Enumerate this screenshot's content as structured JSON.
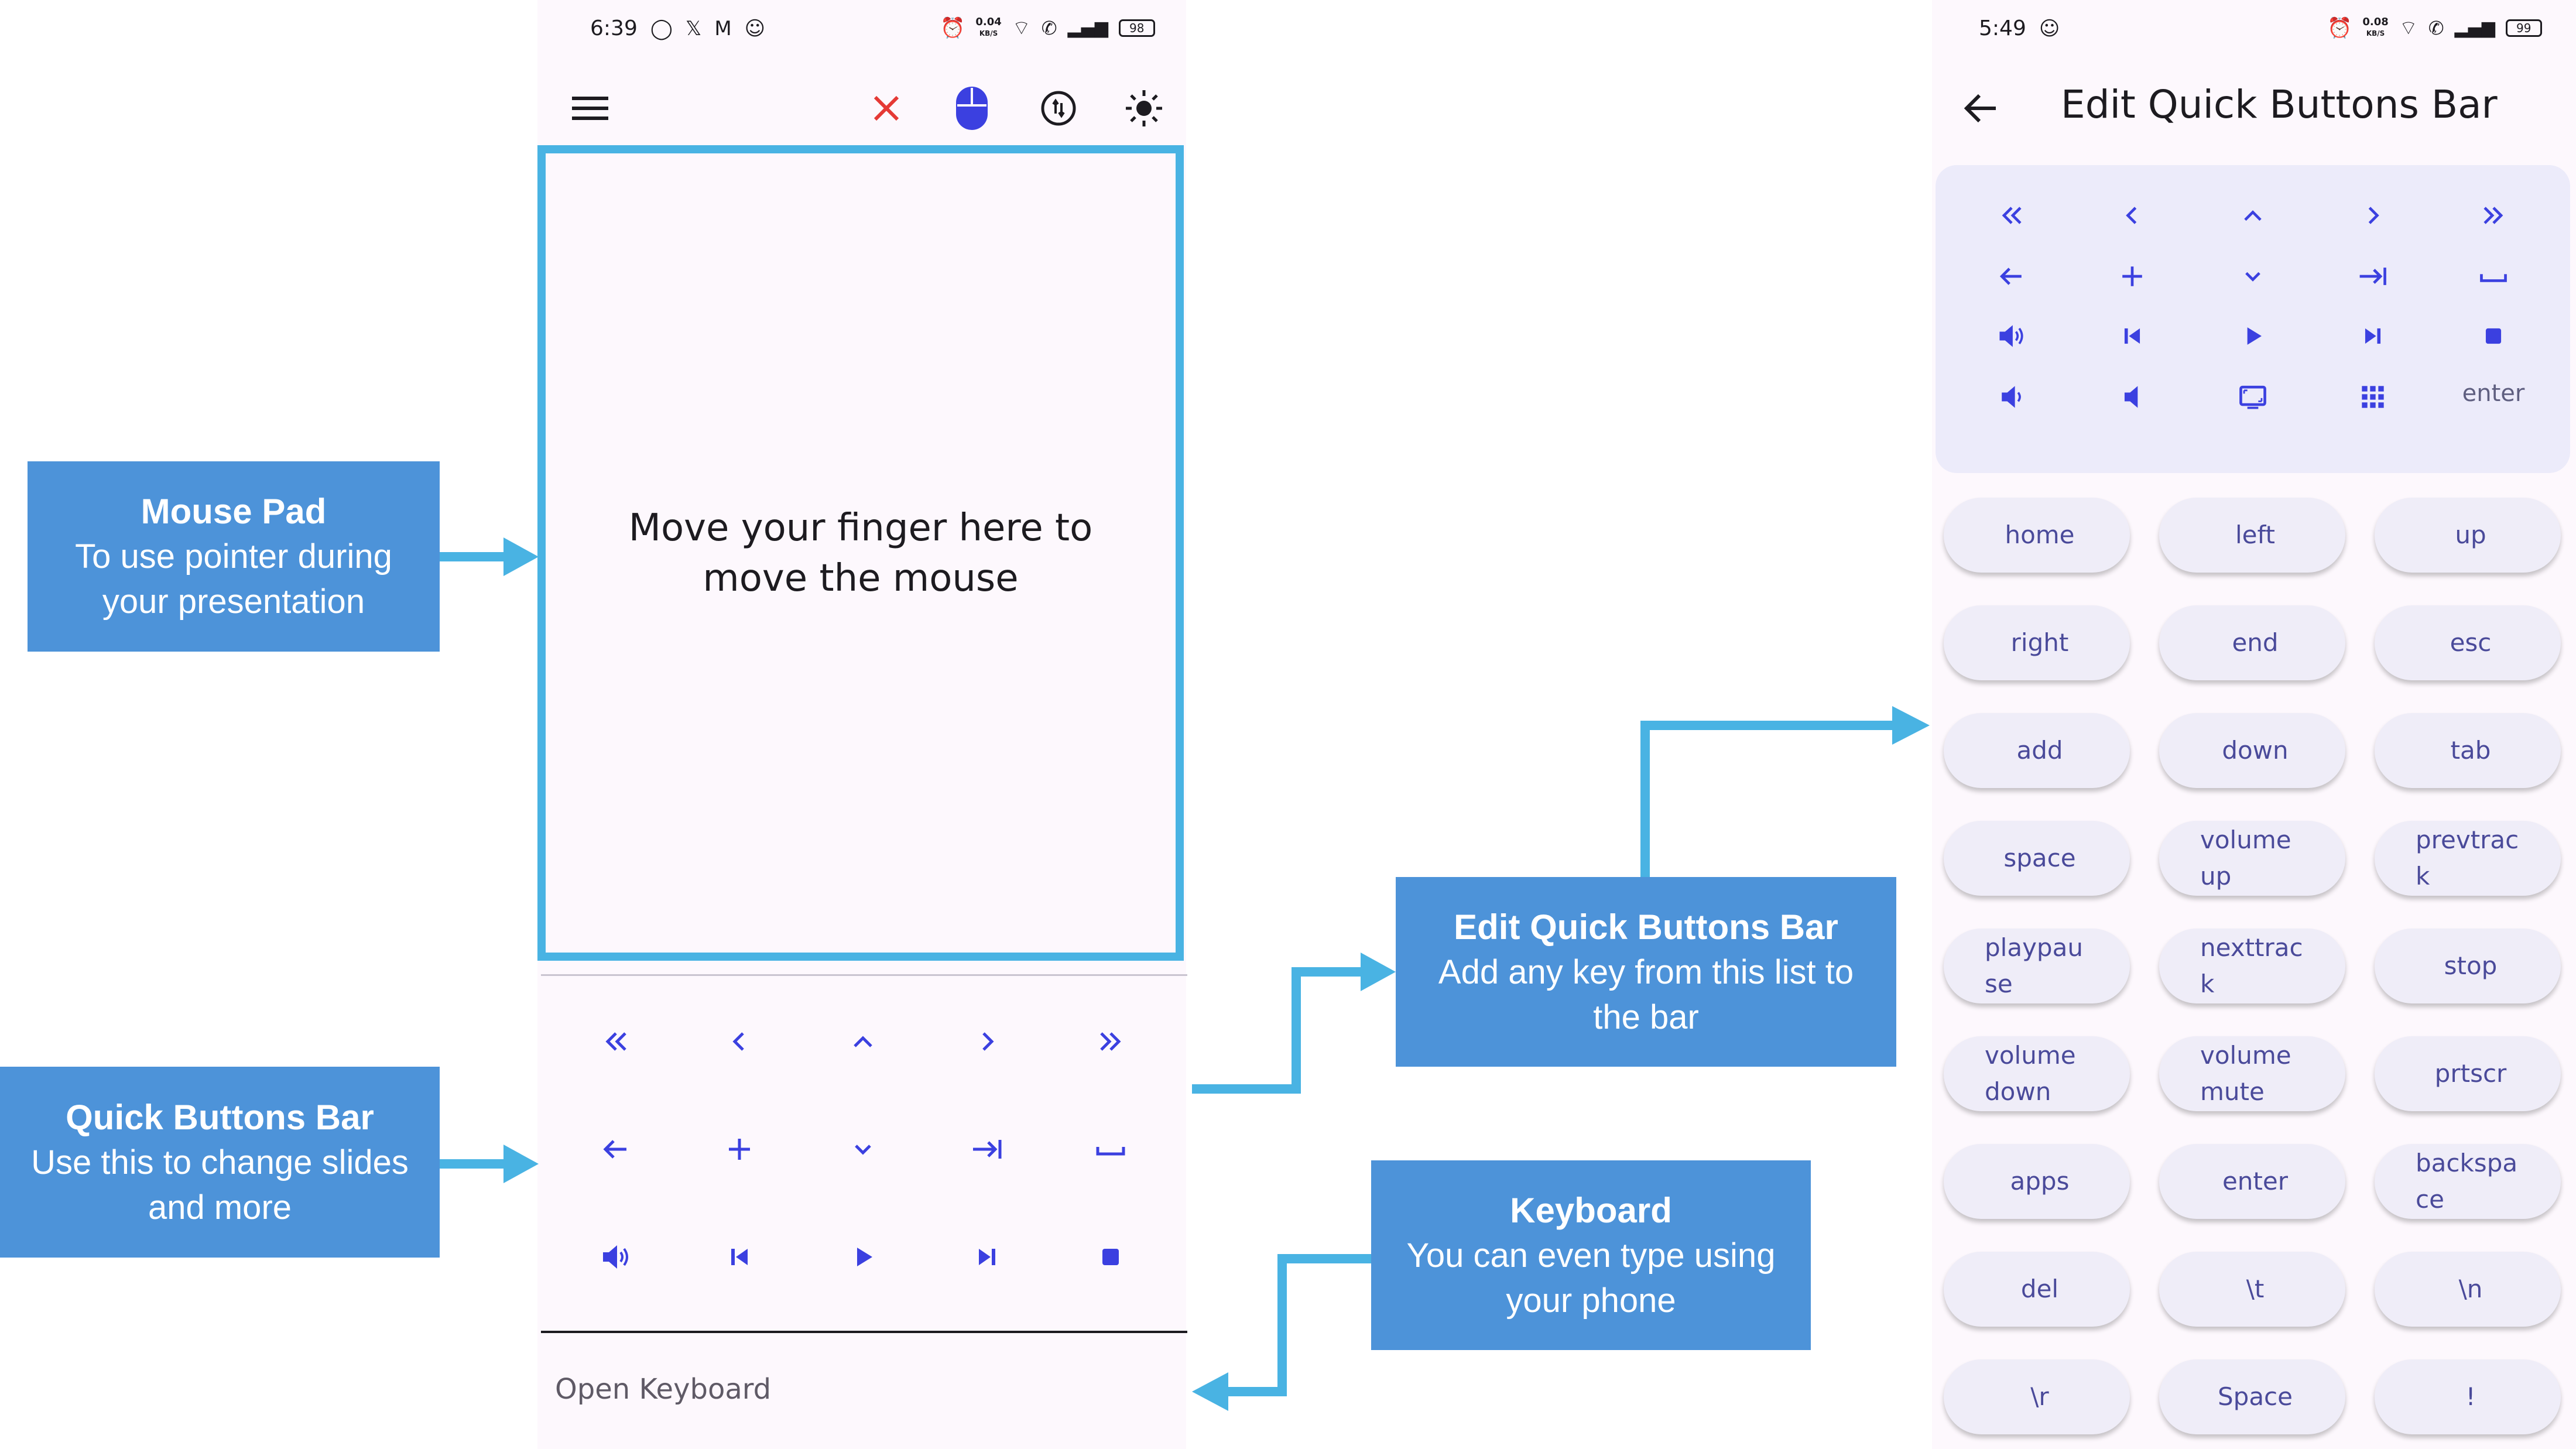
{
  "left_phone": {
    "status_time": "6:39",
    "status_speed_top": "0.04",
    "status_speed_unit": "KB/S",
    "battery": "98",
    "mousepad_text": "Move your finger here to move the mouse",
    "open_keyboard": "Open Keyboard",
    "quick_buttons": [
      [
        "rewind-double-chevron-left-icon",
        "chevron-left-icon",
        "chevron-up-icon",
        "chevron-right-icon",
        "double-chevron-right-icon"
      ],
      [
        "arrow-left-icon",
        "plus-icon",
        "chevron-down-icon",
        "tab-arrow-icon",
        "space-bar-icon"
      ],
      [
        "volume-up-icon",
        "skip-previous-icon",
        "play-icon",
        "skip-next-icon",
        "stop-icon"
      ]
    ]
  },
  "right_phone": {
    "status_time": "5:49",
    "status_speed_top": "0.08",
    "status_speed_unit": "KB/S",
    "battery": "99",
    "title": "Edit Quick Buttons Bar",
    "quick_bar_enter": "enter",
    "chips": [
      "home",
      "left",
      "up",
      "right",
      "end",
      "esc",
      "add",
      "down",
      "tab",
      "space",
      "volume up",
      "prevtrack",
      "playpause",
      "nexttrack",
      "stop",
      "volume down",
      "volume mute",
      "prtscr",
      "apps",
      "enter",
      "backspace",
      "del",
      "\\t",
      "\\n",
      "\\r",
      "Space",
      "!"
    ]
  },
  "callouts": {
    "mouse_pad": {
      "title": "Mouse Pad",
      "desc": "To use pointer during your presentation"
    },
    "quick_buttons": {
      "title": "Quick Buttons Bar",
      "desc": "Use this to change slides and more"
    },
    "edit_bar": {
      "title": "Edit Quick Buttons Bar",
      "desc": "Add any key from this list to the bar"
    },
    "keyboard": {
      "title": "Keyboard",
      "desc": "You can even type using your phone"
    }
  },
  "colors": {
    "accent": "#3b40e0",
    "callout": "#4d93d9",
    "arrow": "#49b3e3",
    "close_red": "#e53935"
  }
}
